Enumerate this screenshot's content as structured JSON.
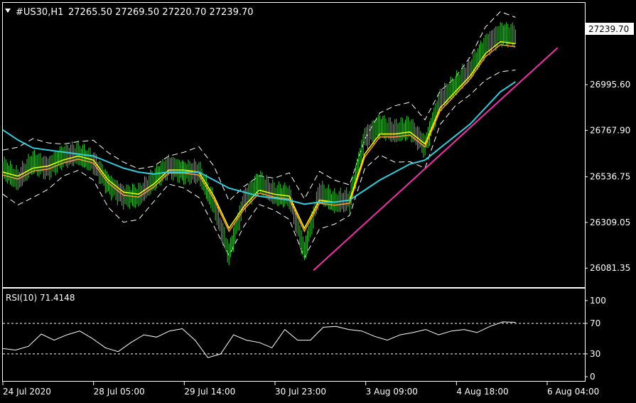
{
  "header": {
    "symbol": "#US30,H1",
    "ohlc": "27265.50 27269.50 27220.70 27239.70",
    "dropdown_icon": "triangle-down-icon"
  },
  "price_axis": {
    "current_price": "27239.70",
    "ticks": [
      "26995.60",
      "26767.90",
      "26536.75",
      "26309.05",
      "26081.35"
    ]
  },
  "rsi": {
    "label": "RSI(10) 71.4148",
    "ticks": [
      "100",
      "70",
      "30",
      "0"
    ],
    "levels": [
      70,
      30
    ]
  },
  "time_axis": {
    "ticks": [
      "24 Jul 2020",
      "28 Jul 05:00",
      "29 Jul 14:00",
      "30 Jul 23:00",
      "3 Aug 09:00",
      "4 Aug 18:00",
      "6 Aug 04:00"
    ]
  },
  "colors": {
    "background": "#000000",
    "frame": "#ffffff",
    "candles": "#33cc33",
    "ma_fast": "#ffff00",
    "ma_mid": "#ff9933",
    "ma_slow": "#33ccdd",
    "trendline": "#ee33aa",
    "bands": "#ffffff",
    "rsi_line": "#ffffff",
    "current_price_bg": "#ffffff",
    "current_price_text": "#000000"
  },
  "chart_data": {
    "type": "line",
    "title": "#US30,H1",
    "ylim": [
      25990,
      27400
    ],
    "x": [
      0,
      5,
      10,
      15,
      20,
      25,
      30,
      35,
      40,
      45,
      50,
      55,
      60,
      65,
      70,
      75,
      80,
      85,
      90,
      95,
      100,
      105,
      110,
      115,
      120,
      125,
      130,
      135,
      140,
      145,
      150,
      155,
      160,
      165,
      170
    ],
    "series": [
      {
        "name": "price",
        "values": [
          26580,
          26520,
          26610,
          26580,
          26640,
          26650,
          26610,
          26500,
          26440,
          26440,
          26520,
          26590,
          26560,
          26560,
          26400,
          26150,
          26420,
          26510,
          26450,
          26440,
          26160,
          26460,
          26410,
          26420,
          26730,
          26790,
          26760,
          26780,
          26690,
          26920,
          26990,
          27070,
          27190,
          27250,
          27239.7
        ]
      },
      {
        "name": "ma_fast",
        "values": [
          26560,
          26540,
          26580,
          26590,
          26620,
          26640,
          26620,
          26520,
          26460,
          26450,
          26500,
          26570,
          26570,
          26560,
          26440,
          26280,
          26390,
          26470,
          26450,
          26440,
          26280,
          26420,
          26410,
          26420,
          26650,
          26750,
          26750,
          26760,
          26700,
          26880,
          26960,
          27040,
          27150,
          27210,
          27200
        ]
      },
      {
        "name": "ma_slow",
        "values": [
          26770,
          26720,
          26680,
          26670,
          26660,
          26650,
          26640,
          26610,
          26580,
          26560,
          26550,
          26560,
          26560,
          26560,
          26520,
          26480,
          26460,
          26440,
          26430,
          26420,
          26400,
          26410,
          26410,
          26420,
          26470,
          26520,
          26560,
          26600,
          26620,
          26680,
          26740,
          26800,
          26880,
          26960,
          27010
        ]
      }
    ],
    "trendline": {
      "from": [
        103,
        26070
      ],
      "to": [
        184,
        27180
      ]
    },
    "rsi": {
      "ylim": [
        0,
        100
      ],
      "values": [
        37,
        35,
        40,
        56,
        48,
        55,
        60,
        50,
        38,
        33,
        45,
        55,
        52,
        60,
        63,
        48,
        25,
        30,
        55,
        48,
        45,
        38,
        62,
        48,
        48,
        65,
        66,
        62,
        60,
        53,
        48,
        55,
        58,
        62,
        55,
        60,
        62,
        58,
        66,
        72,
        71.4
      ]
    }
  }
}
